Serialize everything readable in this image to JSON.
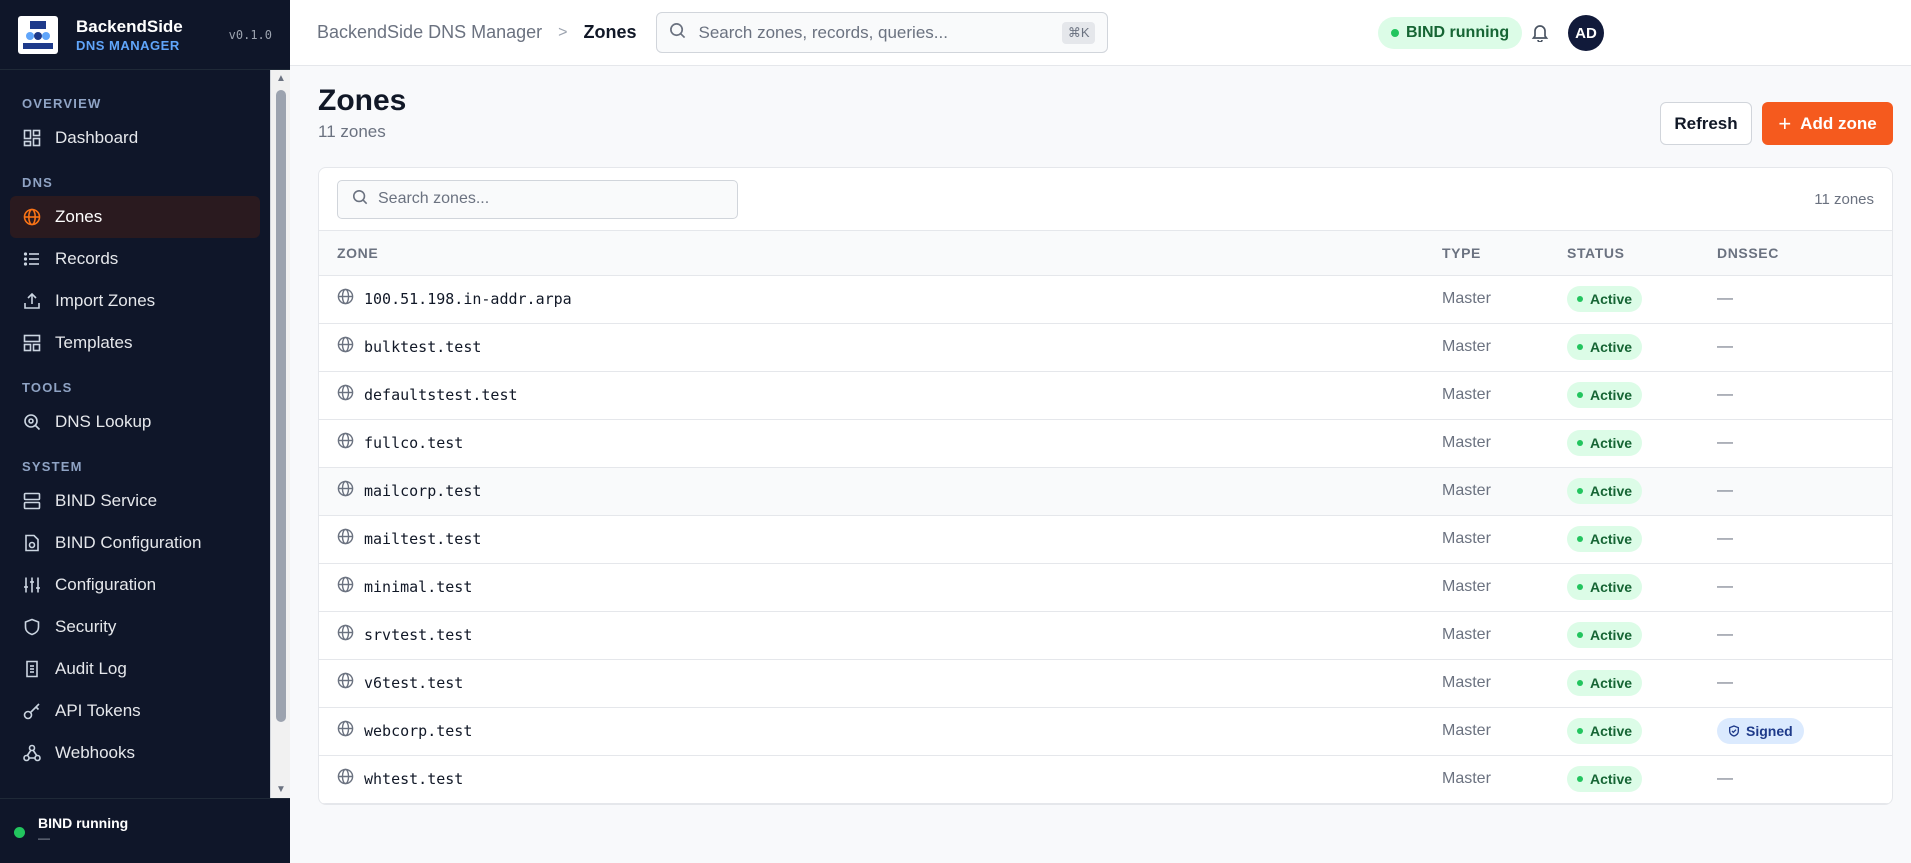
{
  "app": {
    "name": "BackendSide",
    "subtitle": "DNS MANAGER",
    "version": "v0.1.0",
    "logo_text": "BackendSide"
  },
  "sidebar": {
    "sections": [
      {
        "title": "OVERVIEW",
        "items": [
          {
            "label": "Dashboard",
            "icon": "dashboard-icon"
          }
        ]
      },
      {
        "title": "DNS",
        "items": [
          {
            "label": "Zones",
            "icon": "globe-icon",
            "active": true
          },
          {
            "label": "Records",
            "icon": "list-icon"
          },
          {
            "label": "Import Zones",
            "icon": "upload-icon"
          },
          {
            "label": "Templates",
            "icon": "template-icon"
          }
        ]
      },
      {
        "title": "TOOLS",
        "items": [
          {
            "label": "DNS Lookup",
            "icon": "search-icon"
          }
        ]
      },
      {
        "title": "SYSTEM",
        "items": [
          {
            "label": "BIND Service",
            "icon": "server-icon"
          },
          {
            "label": "BIND Configuration",
            "icon": "file-config-icon"
          },
          {
            "label": "Configuration",
            "icon": "sliders-icon"
          },
          {
            "label": "Security",
            "icon": "shield-icon"
          },
          {
            "label": "Audit Log",
            "icon": "scroll-icon"
          },
          {
            "label": "API Tokens",
            "icon": "key-icon"
          },
          {
            "label": "Webhooks",
            "icon": "webhook-icon"
          }
        ]
      }
    ],
    "footer": {
      "title": "BIND running",
      "subtitle": "—"
    }
  },
  "topbar": {
    "breadcrumb": {
      "root": "BackendSide DNS Manager",
      "separator": ">",
      "current": "Zones"
    },
    "search_placeholder": "Search zones, records, queries...",
    "shortcut": "⌘K",
    "status": "BIND running",
    "avatar": "AD"
  },
  "page": {
    "title": "Zones",
    "subtitle": "11 zones",
    "refresh_label": "Refresh",
    "add_label": "Add zone"
  },
  "table": {
    "search_placeholder": "Search zones...",
    "count": "11 zones",
    "columns": [
      "ZONE",
      "TYPE",
      "STATUS",
      "DNSSEC"
    ],
    "rows": [
      {
        "zone": "100.51.198.in-addr.arpa",
        "type": "Master",
        "status": "Active",
        "dnssec": "—"
      },
      {
        "zone": "bulktest.test",
        "type": "Master",
        "status": "Active",
        "dnssec": "—"
      },
      {
        "zone": "defaultstest.test",
        "type": "Master",
        "status": "Active",
        "dnssec": "—"
      },
      {
        "zone": "fullco.test",
        "type": "Master",
        "status": "Active",
        "dnssec": "—"
      },
      {
        "zone": "mailcorp.test",
        "type": "Master",
        "status": "Active",
        "dnssec": "—",
        "highlighted": true
      },
      {
        "zone": "mailtest.test",
        "type": "Master",
        "status": "Active",
        "dnssec": "—"
      },
      {
        "zone": "minimal.test",
        "type": "Master",
        "status": "Active",
        "dnssec": "—"
      },
      {
        "zone": "srvtest.test",
        "type": "Master",
        "status": "Active",
        "dnssec": "—"
      },
      {
        "zone": "v6test.test",
        "type": "Master",
        "status": "Active",
        "dnssec": "—"
      },
      {
        "zone": "webcorp.test",
        "type": "Master",
        "status": "Active",
        "dnssec": "Signed"
      },
      {
        "zone": "whtest.test",
        "type": "Master",
        "status": "Active",
        "dnssec": "—"
      }
    ]
  },
  "colors": {
    "accent": "#f55a1e",
    "sidebar_bg": "#0f1629",
    "success": "#22c55e",
    "brand_blue": "#60a5fa"
  }
}
